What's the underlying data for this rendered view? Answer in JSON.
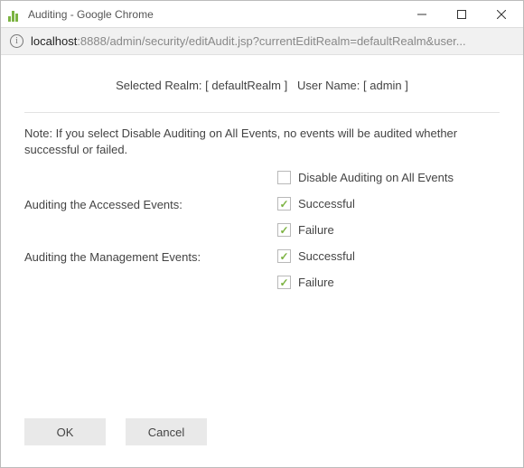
{
  "window": {
    "title": "Auditing - Google Chrome",
    "url_host": "localhost",
    "url_rest": ":8888/admin/security/editAudit.jsp?currentEditRealm=defaultRealm&user..."
  },
  "header": {
    "realm_label": "Selected Realm:",
    "realm_value": "[ defaultRealm ]",
    "user_label": "User Name:",
    "user_value": "[ admin ]"
  },
  "note": "Note: If you select Disable Auditing on All Events, no events will be audited whether successful or failed.",
  "form": {
    "disable_all": {
      "label": "Disable Auditing on All Events",
      "checked": false
    },
    "accessed": {
      "label": "Auditing the Accessed Events:",
      "successful": {
        "label": "Successful",
        "checked": true
      },
      "failure": {
        "label": "Failure",
        "checked": true
      }
    },
    "management": {
      "label": "Auditing the Management Events:",
      "successful": {
        "label": "Successful",
        "checked": true
      },
      "failure": {
        "label": "Failure",
        "checked": true
      }
    }
  },
  "buttons": {
    "ok": "OK",
    "cancel": "Cancel"
  }
}
